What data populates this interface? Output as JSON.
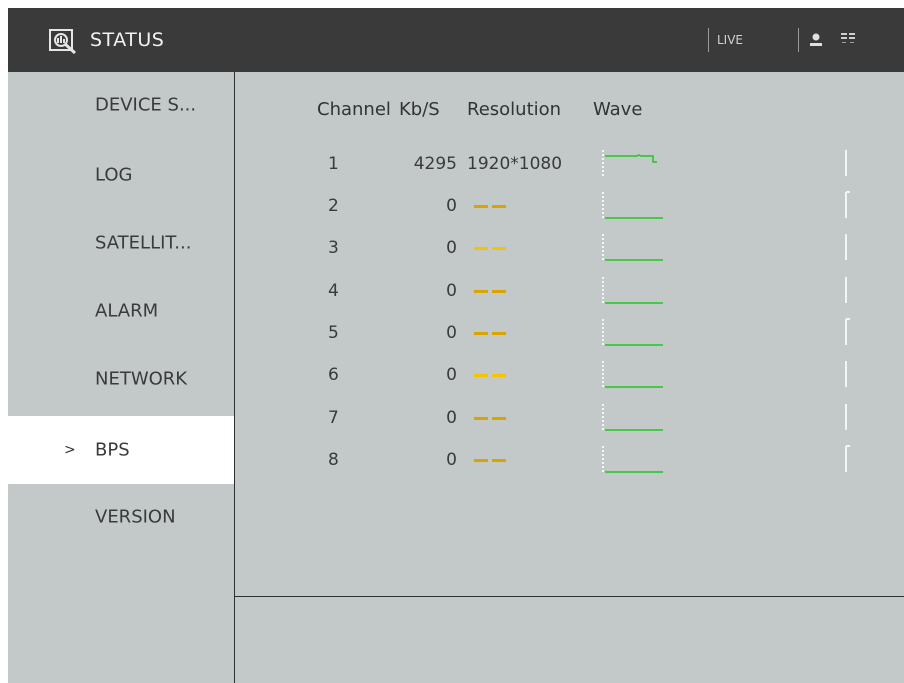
{
  "header": {
    "title": "STATUS",
    "live_label": "LIVE"
  },
  "sidebar": {
    "items": [
      {
        "label": "DEVICE S..."
      },
      {
        "label": "LOG"
      },
      {
        "label": "SATELLIT..."
      },
      {
        "label": "ALARM"
      },
      {
        "label": "NETWORK"
      },
      {
        "label": "BPS",
        "active": true
      },
      {
        "label": "VERSION"
      }
    ],
    "active_marker": ">"
  },
  "table": {
    "headers": {
      "channel": "Channel",
      "kbs": "Kb/S",
      "resolution": "Resolution",
      "wave": "Wave"
    },
    "rows": [
      {
        "channel": "1",
        "kbs": "4295",
        "resolution": "1920*1080"
      },
      {
        "channel": "2",
        "kbs": "0",
        "resolution": "--"
      },
      {
        "channel": "3",
        "kbs": "0",
        "resolution": "--"
      },
      {
        "channel": "4",
        "kbs": "0",
        "resolution": "--"
      },
      {
        "channel": "5",
        "kbs": "0",
        "resolution": "--"
      },
      {
        "channel": "6",
        "kbs": "0",
        "resolution": "--"
      },
      {
        "channel": "7",
        "kbs": "0",
        "resolution": "--"
      },
      {
        "channel": "8",
        "kbs": "0",
        "resolution": "--"
      }
    ]
  },
  "colors": {
    "titlebar": "#3a3a3a",
    "panel": "#c3c9c9",
    "active_item": "#ffffff",
    "wave_green": "#1ec81e",
    "dash_dark": "#d9a300",
    "dash_light": "#f2c500"
  },
  "icons": {
    "logo": "status-magnifier-icon",
    "user": "user-icon",
    "language": "language-icon"
  }
}
